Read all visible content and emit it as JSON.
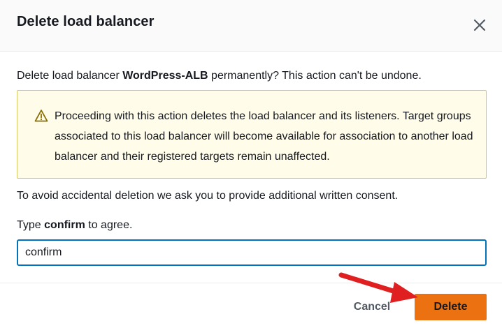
{
  "dialog": {
    "title": "Delete load balancer",
    "intro_prefix": "Delete load balancer ",
    "load_balancer_name": "WordPress-ALB",
    "intro_suffix": " permanently? This action can't be undone.",
    "warning": {
      "icon": "warning-triangle-icon",
      "text": "Proceeding with this action deletes the load balancer and its listeners. Target groups associated to this load balancer will become available for association to another load balancer and their registered targets remain unaffected."
    },
    "consent_text": "To avoid accidental deletion we ask you to provide additional written consent.",
    "type_prefix": "Type ",
    "type_keyword": "confirm",
    "type_suffix": " to agree.",
    "input_value": "confirm",
    "cancel_label": "Cancel",
    "delete_label": "Delete"
  },
  "colors": {
    "accent_input": "#0073bb",
    "delete_button": "#ec7211",
    "warning_bg": "#fffce9",
    "warning_border": "#d8c76a",
    "annotation_arrow": "#e02020"
  }
}
